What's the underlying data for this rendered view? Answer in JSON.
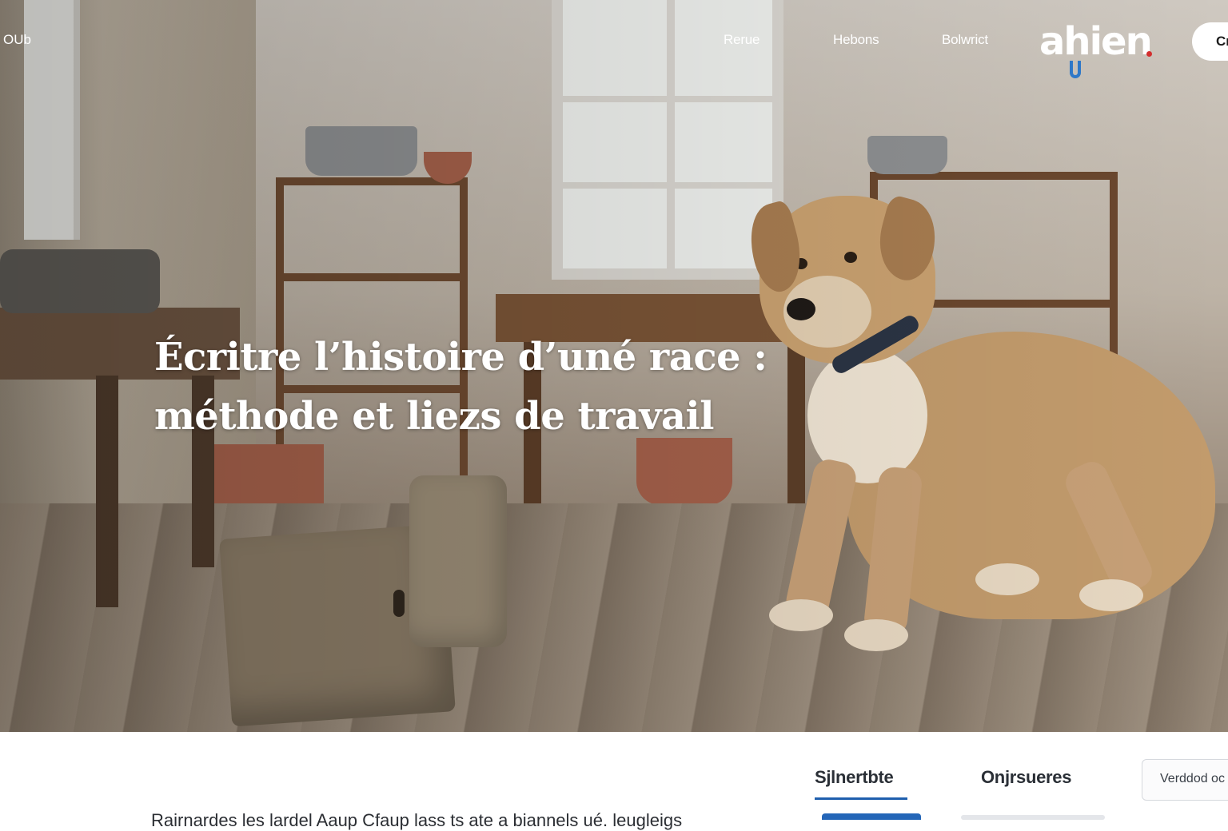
{
  "nav": {
    "left_label": "OUb",
    "links": [
      "Rerue",
      "Hebons",
      "Bolwrict"
    ],
    "cta_label": "Cr"
  },
  "logo": {
    "text": "ahien"
  },
  "hero": {
    "headline_line1": "Écritre l’histoire d’uné race :",
    "headline_line2": "méthode et liezs de travail"
  },
  "below": {
    "tabs": [
      "Sjlnertbte",
      "Onjrsueres"
    ],
    "active_tab_index": 0,
    "verify_label": "Verddod oc",
    "intro_text": "Rairnardes les lardel Aaup Cfaup lass ts ate a biannels ué. leugleigs"
  },
  "colors": {
    "active_tab_accent": "#1f5fae",
    "logo_accent_blue": "#2f78c8",
    "logo_accent_red": "#d32f2f"
  },
  "icons": [
    "dog-photo-image",
    "logo-mark-icon"
  ]
}
